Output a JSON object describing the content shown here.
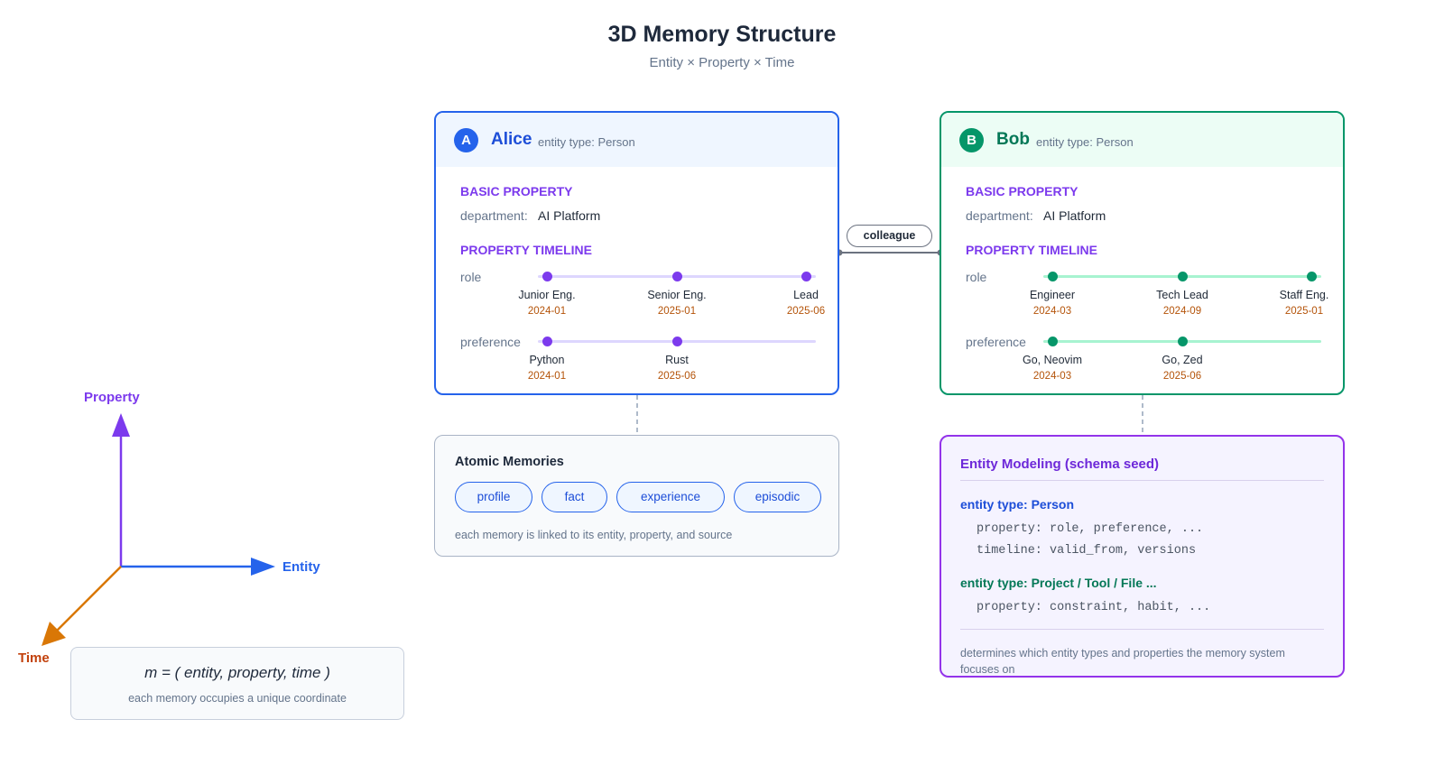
{
  "header": {
    "title": "3D Memory Structure",
    "subtitle": "Entity × Property × Time"
  },
  "colors": {
    "alice": "#2563eb",
    "bob": "#059669",
    "property": "#7c3aed",
    "time": "#d97706",
    "schema": "#9333ea"
  },
  "alice": {
    "badge": "A",
    "name": "Alice",
    "entity_type": "entity type: Person",
    "basic_heading": "BASIC PROPERTY",
    "basic_label": "department:",
    "basic_value": "AI Platform",
    "timeline_heading": "PROPERTY TIMELINE",
    "role_label": "role",
    "role_points": [
      {
        "name": "Junior Eng.",
        "date": "2024-01"
      },
      {
        "name": "Senior Eng.",
        "date": "2025-01"
      },
      {
        "name": "Lead",
        "date": "2025-06"
      }
    ],
    "pref_label": "preference",
    "pref_points": [
      {
        "name": "Python",
        "date": "2024-01"
      },
      {
        "name": "Rust",
        "date": "2025-06"
      }
    ]
  },
  "bob": {
    "badge": "B",
    "name": "Bob",
    "entity_type": "entity type: Person",
    "basic_heading": "BASIC PROPERTY",
    "basic_label": "department:",
    "basic_value": "AI Platform",
    "timeline_heading": "PROPERTY TIMELINE",
    "role_label": "role",
    "role_points": [
      {
        "name": "Engineer",
        "date": "2024-03"
      },
      {
        "name": "Tech Lead",
        "date": "2024-09"
      },
      {
        "name": "Staff Eng.",
        "date": "2025-01"
      }
    ],
    "pref_label": "preference",
    "pref_points": [
      {
        "name": "Go, Neovim",
        "date": "2024-03"
      },
      {
        "name": "Go, Zed",
        "date": "2025-06"
      }
    ]
  },
  "relation": {
    "label": "colleague"
  },
  "atomic": {
    "title": "Atomic Memories",
    "chips": [
      "profile",
      "fact",
      "experience",
      "episodic"
    ],
    "note": "each memory is linked to its entity, property, and source"
  },
  "schema": {
    "title": "Entity Modeling (schema seed)",
    "type1": "entity type: Person",
    "type1_line1": "property: role, preference, ...",
    "type1_line2": "timeline: valid_from, versions",
    "type2": "entity type: Project / Tool / File ...",
    "type2_line1": "property: constraint, habit, ...",
    "note": "determines which entity types and properties the memory system focuses on"
  },
  "axes": {
    "property": "Property",
    "entity": "Entity",
    "time": "Time"
  },
  "formula": {
    "equation": "m = ( entity, property, time )",
    "note": "each memory occupies a unique coordinate"
  }
}
